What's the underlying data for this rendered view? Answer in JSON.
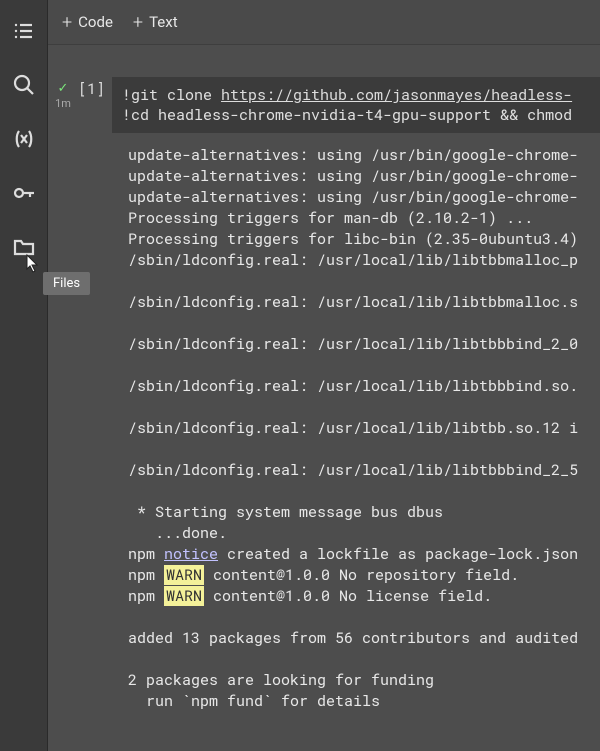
{
  "toolbar": {
    "code_label": "Code",
    "text_label": "Text"
  },
  "sidebar": {
    "tooltip": "Files",
    "icons": [
      "toc-icon",
      "search-icon",
      "variables-icon",
      "key-icon",
      "folder-icon"
    ]
  },
  "cell": {
    "prompt": "[1]",
    "exec_time": "1m",
    "status": "ok",
    "code_line1_prefix": "!git clone ",
    "code_line1_url": "https://github.com/jasonmayes/headless-",
    "code_line2": "!cd headless-chrome-nvidia-t4-gpu-support && chmod"
  },
  "output": {
    "lines": [
      "update-alternatives: using /usr/bin/google-chrome-",
      "update-alternatives: using /usr/bin/google-chrome-",
      "update-alternatives: using /usr/bin/google-chrome-",
      "Processing triggers for man-db (2.10.2-1) ...",
      "Processing triggers for libc-bin (2.35-0ubuntu3.4)",
      "/sbin/ldconfig.real: /usr/local/lib/libtbbmalloc_p",
      "",
      "/sbin/ldconfig.real: /usr/local/lib/libtbbmalloc.s",
      "",
      "/sbin/ldconfig.real: /usr/local/lib/libtbbbind_2_0",
      "",
      "/sbin/ldconfig.real: /usr/local/lib/libtbbbind.so.",
      "",
      "/sbin/ldconfig.real: /usr/local/lib/libtbb.so.12 i",
      "",
      "/sbin/ldconfig.real: /usr/local/lib/libtbbbind_2_5",
      "",
      " * Starting system message bus dbus",
      "   ...done."
    ],
    "npm_notice_prefix": "npm ",
    "npm_notice_word": "notice",
    "npm_notice_rest": " created a lockfile as package-lock.json",
    "npm_warn1_prefix": "npm ",
    "npm_warn1_word": "WARN",
    "npm_warn1_rest": " content@1.0.0 No repository field.",
    "npm_warn2_prefix": "npm ",
    "npm_warn2_word": "WARN",
    "npm_warn2_rest": " content@1.0.0 No license field.",
    "tail": [
      "",
      "added 13 packages from 56 contributors and audited",
      "",
      "2 packages are looking for funding",
      "  run `npm fund` for details"
    ]
  }
}
